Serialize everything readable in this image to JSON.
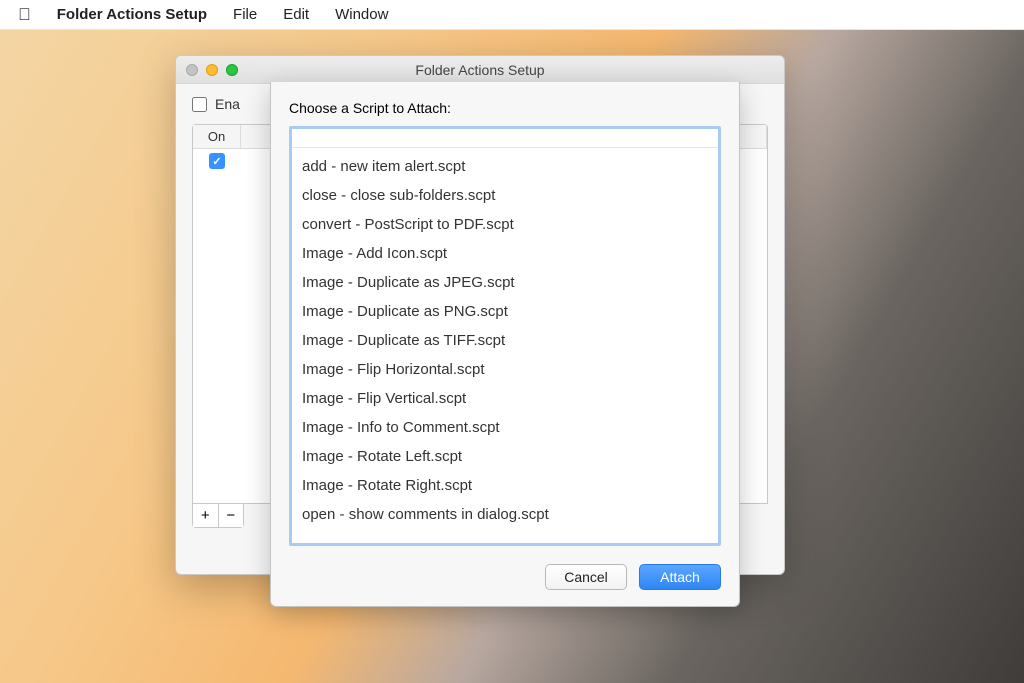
{
  "menubar": {
    "app_name": "Folder Actions Setup",
    "items": [
      "File",
      "Edit",
      "Window"
    ]
  },
  "window": {
    "title": "Folder Actions Setup",
    "enable_checkbox_label_prefix": "Ena",
    "folders": {
      "columns": {
        "on": "On",
        "name": ""
      },
      "rows": [
        {
          "checked": true
        }
      ]
    },
    "buttons": {
      "add": "+",
      "remove": "−"
    }
  },
  "sheet": {
    "title": "Choose a Script to Attach:",
    "scripts": [
      "add - new item alert.scpt",
      "close - close sub-folders.scpt",
      "convert - PostScript to PDF.scpt",
      "Image - Add Icon.scpt",
      "Image - Duplicate as JPEG.scpt",
      "Image - Duplicate as PNG.scpt",
      "Image - Duplicate as TIFF.scpt",
      "Image - Flip Horizontal.scpt",
      "Image - Flip Vertical.scpt",
      "Image - Info to Comment.scpt",
      "Image - Rotate Left.scpt",
      "Image - Rotate Right.scpt",
      "open - show comments in dialog.scpt"
    ],
    "buttons": {
      "cancel": "Cancel",
      "attach": "Attach"
    }
  }
}
